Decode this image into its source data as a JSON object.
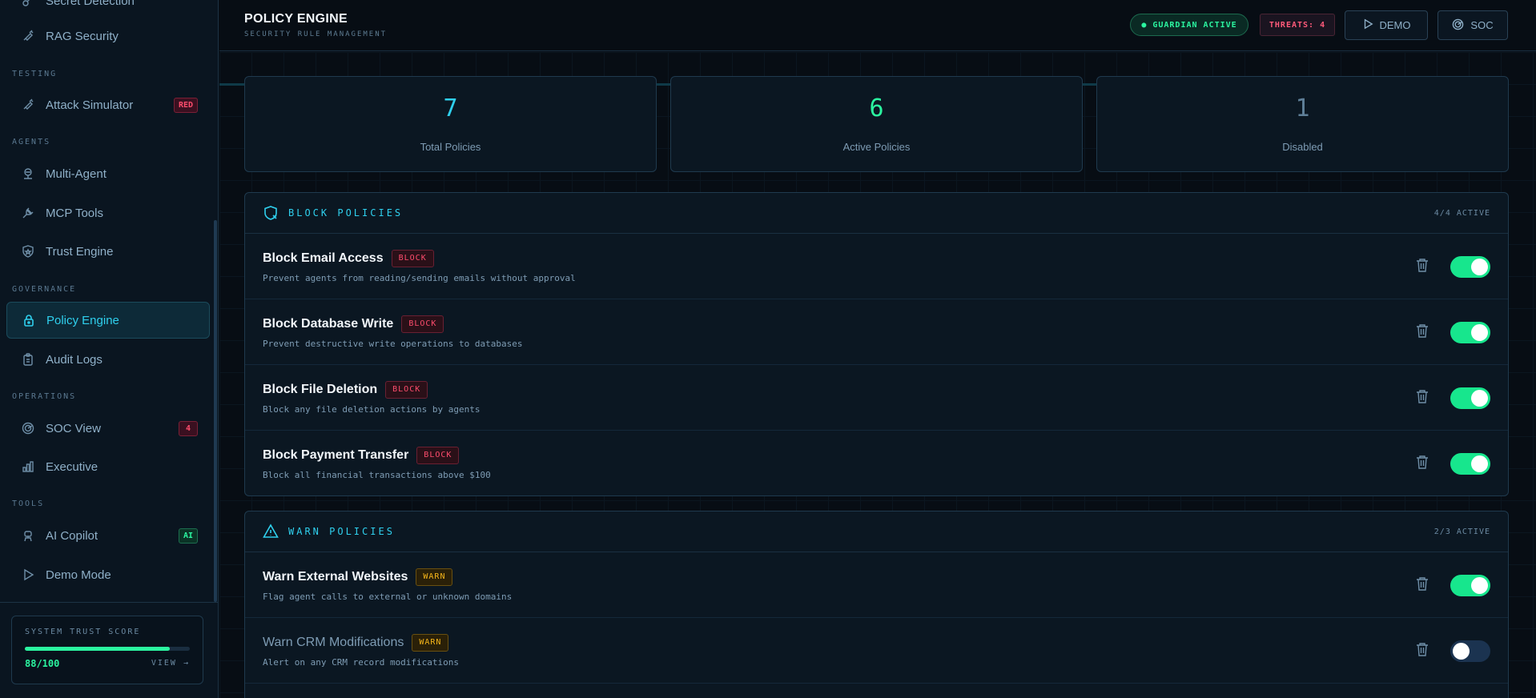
{
  "sidebar": {
    "partial_top_item": "Secret Detection",
    "sections": {
      "testing": "TESTING",
      "agents": "AGENTS",
      "governance": "GOVERNANCE",
      "operations": "OPERATIONS",
      "tools": "TOOLS"
    },
    "items": {
      "rag_security": "RAG Security",
      "attack_simulator": "Attack Simulator",
      "attack_simulator_badge": "RED",
      "multi_agent": "Multi-Agent",
      "mcp_tools": "MCP Tools",
      "trust_engine": "Trust Engine",
      "policy_engine": "Policy Engine",
      "audit_logs": "Audit Logs",
      "soc_view": "SOC View",
      "soc_view_badge": "4",
      "executive": "Executive",
      "ai_copilot": "AI Copilot",
      "ai_copilot_badge": "AI",
      "demo_mode": "Demo Mode"
    },
    "trust": {
      "label": "SYSTEM TRUST SCORE",
      "score": "88/100",
      "fraction": 0.88,
      "view": "VIEW →"
    }
  },
  "header": {
    "title": "POLICY ENGINE",
    "subtitle": "SECURITY RULE MANAGEMENT",
    "guardian": "● GUARDIAN ACTIVE",
    "threats": "THREATS: 4",
    "demo": "DEMO",
    "soc": "SOC"
  },
  "stats": {
    "total": "7",
    "total_label": "Total Policies",
    "active": "6",
    "active_label": "Active Policies",
    "disabled": "1",
    "disabled_label": "Disabled"
  },
  "block_panel": {
    "title": "BLOCK POLICIES",
    "count": "4/4 ACTIVE",
    "tag": "BLOCK",
    "rows": [
      {
        "title": "Block Email Access",
        "desc": "Prevent agents from reading/sending emails without approval"
      },
      {
        "title": "Block Database Write",
        "desc": "Prevent destructive write operations to databases"
      },
      {
        "title": "Block File Deletion",
        "desc": "Block any file deletion actions by agents"
      },
      {
        "title": "Block Payment Transfer",
        "desc": "Block all financial transactions above $100"
      }
    ]
  },
  "warn_panel": {
    "title": "WARN POLICIES",
    "count": "2/3 ACTIVE",
    "tag": "WARN",
    "rows": [
      {
        "title": "Warn External Websites",
        "desc": "Flag agent calls to external or unknown domains"
      },
      {
        "title": "Warn CRM Modifications",
        "desc": "Alert on any CRM record modifications"
      }
    ]
  },
  "colors": {
    "accent": "#2fd0ee",
    "success": "#2bf5a0",
    "danger": "#ff4d6d",
    "warn": "#f5b51a"
  }
}
